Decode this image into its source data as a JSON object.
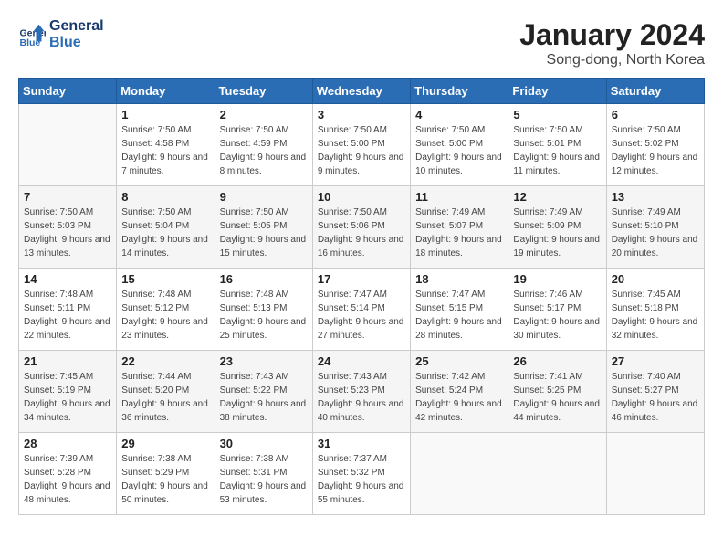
{
  "header": {
    "logo_line1": "General",
    "logo_line2": "Blue",
    "month_title": "January 2024",
    "location": "Song-dong, North Korea"
  },
  "days_of_week": [
    "Sunday",
    "Monday",
    "Tuesday",
    "Wednesday",
    "Thursday",
    "Friday",
    "Saturday"
  ],
  "weeks": [
    [
      {
        "num": "",
        "sunrise": "",
        "sunset": "",
        "daylight": ""
      },
      {
        "num": "1",
        "sunrise": "Sunrise: 7:50 AM",
        "sunset": "Sunset: 4:58 PM",
        "daylight": "Daylight: 9 hours and 7 minutes."
      },
      {
        "num": "2",
        "sunrise": "Sunrise: 7:50 AM",
        "sunset": "Sunset: 4:59 PM",
        "daylight": "Daylight: 9 hours and 8 minutes."
      },
      {
        "num": "3",
        "sunrise": "Sunrise: 7:50 AM",
        "sunset": "Sunset: 5:00 PM",
        "daylight": "Daylight: 9 hours and 9 minutes."
      },
      {
        "num": "4",
        "sunrise": "Sunrise: 7:50 AM",
        "sunset": "Sunset: 5:00 PM",
        "daylight": "Daylight: 9 hours and 10 minutes."
      },
      {
        "num": "5",
        "sunrise": "Sunrise: 7:50 AM",
        "sunset": "Sunset: 5:01 PM",
        "daylight": "Daylight: 9 hours and 11 minutes."
      },
      {
        "num": "6",
        "sunrise": "Sunrise: 7:50 AM",
        "sunset": "Sunset: 5:02 PM",
        "daylight": "Daylight: 9 hours and 12 minutes."
      }
    ],
    [
      {
        "num": "7",
        "sunrise": "Sunrise: 7:50 AM",
        "sunset": "Sunset: 5:03 PM",
        "daylight": "Daylight: 9 hours and 13 minutes."
      },
      {
        "num": "8",
        "sunrise": "Sunrise: 7:50 AM",
        "sunset": "Sunset: 5:04 PM",
        "daylight": "Daylight: 9 hours and 14 minutes."
      },
      {
        "num": "9",
        "sunrise": "Sunrise: 7:50 AM",
        "sunset": "Sunset: 5:05 PM",
        "daylight": "Daylight: 9 hours and 15 minutes."
      },
      {
        "num": "10",
        "sunrise": "Sunrise: 7:50 AM",
        "sunset": "Sunset: 5:06 PM",
        "daylight": "Daylight: 9 hours and 16 minutes."
      },
      {
        "num": "11",
        "sunrise": "Sunrise: 7:49 AM",
        "sunset": "Sunset: 5:07 PM",
        "daylight": "Daylight: 9 hours and 18 minutes."
      },
      {
        "num": "12",
        "sunrise": "Sunrise: 7:49 AM",
        "sunset": "Sunset: 5:09 PM",
        "daylight": "Daylight: 9 hours and 19 minutes."
      },
      {
        "num": "13",
        "sunrise": "Sunrise: 7:49 AM",
        "sunset": "Sunset: 5:10 PM",
        "daylight": "Daylight: 9 hours and 20 minutes."
      }
    ],
    [
      {
        "num": "14",
        "sunrise": "Sunrise: 7:48 AM",
        "sunset": "Sunset: 5:11 PM",
        "daylight": "Daylight: 9 hours and 22 minutes."
      },
      {
        "num": "15",
        "sunrise": "Sunrise: 7:48 AM",
        "sunset": "Sunset: 5:12 PM",
        "daylight": "Daylight: 9 hours and 23 minutes."
      },
      {
        "num": "16",
        "sunrise": "Sunrise: 7:48 AM",
        "sunset": "Sunset: 5:13 PM",
        "daylight": "Daylight: 9 hours and 25 minutes."
      },
      {
        "num": "17",
        "sunrise": "Sunrise: 7:47 AM",
        "sunset": "Sunset: 5:14 PM",
        "daylight": "Daylight: 9 hours and 27 minutes."
      },
      {
        "num": "18",
        "sunrise": "Sunrise: 7:47 AM",
        "sunset": "Sunset: 5:15 PM",
        "daylight": "Daylight: 9 hours and 28 minutes."
      },
      {
        "num": "19",
        "sunrise": "Sunrise: 7:46 AM",
        "sunset": "Sunset: 5:17 PM",
        "daylight": "Daylight: 9 hours and 30 minutes."
      },
      {
        "num": "20",
        "sunrise": "Sunrise: 7:45 AM",
        "sunset": "Sunset: 5:18 PM",
        "daylight": "Daylight: 9 hours and 32 minutes."
      }
    ],
    [
      {
        "num": "21",
        "sunrise": "Sunrise: 7:45 AM",
        "sunset": "Sunset: 5:19 PM",
        "daylight": "Daylight: 9 hours and 34 minutes."
      },
      {
        "num": "22",
        "sunrise": "Sunrise: 7:44 AM",
        "sunset": "Sunset: 5:20 PM",
        "daylight": "Daylight: 9 hours and 36 minutes."
      },
      {
        "num": "23",
        "sunrise": "Sunrise: 7:43 AM",
        "sunset": "Sunset: 5:22 PM",
        "daylight": "Daylight: 9 hours and 38 minutes."
      },
      {
        "num": "24",
        "sunrise": "Sunrise: 7:43 AM",
        "sunset": "Sunset: 5:23 PM",
        "daylight": "Daylight: 9 hours and 40 minutes."
      },
      {
        "num": "25",
        "sunrise": "Sunrise: 7:42 AM",
        "sunset": "Sunset: 5:24 PM",
        "daylight": "Daylight: 9 hours and 42 minutes."
      },
      {
        "num": "26",
        "sunrise": "Sunrise: 7:41 AM",
        "sunset": "Sunset: 5:25 PM",
        "daylight": "Daylight: 9 hours and 44 minutes."
      },
      {
        "num": "27",
        "sunrise": "Sunrise: 7:40 AM",
        "sunset": "Sunset: 5:27 PM",
        "daylight": "Daylight: 9 hours and 46 minutes."
      }
    ],
    [
      {
        "num": "28",
        "sunrise": "Sunrise: 7:39 AM",
        "sunset": "Sunset: 5:28 PM",
        "daylight": "Daylight: 9 hours and 48 minutes."
      },
      {
        "num": "29",
        "sunrise": "Sunrise: 7:38 AM",
        "sunset": "Sunset: 5:29 PM",
        "daylight": "Daylight: 9 hours and 50 minutes."
      },
      {
        "num": "30",
        "sunrise": "Sunrise: 7:38 AM",
        "sunset": "Sunset: 5:31 PM",
        "daylight": "Daylight: 9 hours and 53 minutes."
      },
      {
        "num": "31",
        "sunrise": "Sunrise: 7:37 AM",
        "sunset": "Sunset: 5:32 PM",
        "daylight": "Daylight: 9 hours and 55 minutes."
      },
      {
        "num": "",
        "sunrise": "",
        "sunset": "",
        "daylight": ""
      },
      {
        "num": "",
        "sunrise": "",
        "sunset": "",
        "daylight": ""
      },
      {
        "num": "",
        "sunrise": "",
        "sunset": "",
        "daylight": ""
      }
    ]
  ]
}
